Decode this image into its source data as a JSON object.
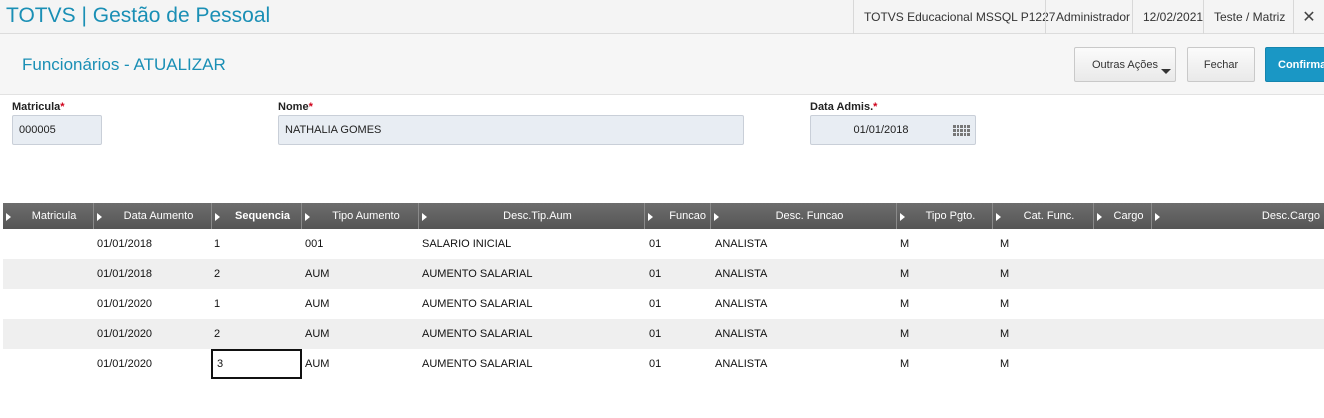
{
  "app": {
    "title": "TOTVS | Gestão de Pessoal"
  },
  "topbar": {
    "environment": "TOTVS Educacional MSSQL P1227",
    "user": "Administrador",
    "date": "12/02/2021",
    "branch": "Teste / Matriz",
    "close_icon": "✕"
  },
  "page": {
    "title": "Funcionários - ATUALIZAR",
    "buttons": {
      "more_actions": "Outras Ações",
      "close": "Fechar",
      "confirm": "Confirmar"
    }
  },
  "form": {
    "matricula": {
      "label": "Matricula",
      "required": "*",
      "value": "000005"
    },
    "nome": {
      "label": "Nome",
      "required": "*",
      "value": "NATHALIA GOMES"
    },
    "data_admis": {
      "label": "Data Admis.",
      "required": "*",
      "value": "01/01/2018"
    }
  },
  "grid": {
    "columns": [
      "Matricula",
      "Data Aumento",
      "Sequencia",
      "Tipo Aumento",
      "Desc.Tip.Aum",
      "Funcao",
      "Desc. Funcao",
      "Tipo Pgto.",
      "Cat. Func.",
      "Cargo",
      "Desc.Cargo"
    ],
    "rows": [
      [
        "",
        "01/01/2018",
        "1",
        "001",
        "SALARIO INICIAL",
        "01",
        "ANALISTA",
        "M",
        "M",
        "",
        ""
      ],
      [
        "",
        "01/01/2018",
        "2",
        "AUM",
        "AUMENTO SALARIAL",
        "01",
        "ANALISTA",
        "M",
        "M",
        "",
        ""
      ],
      [
        "",
        "01/01/2020",
        "1",
        "AUM",
        "AUMENTO SALARIAL",
        "01",
        "ANALISTA",
        "M",
        "M",
        "",
        ""
      ],
      [
        "",
        "01/01/2020",
        "2",
        "AUM",
        "AUMENTO SALARIAL",
        "01",
        "ANALISTA",
        "M",
        "M",
        "",
        ""
      ],
      [
        "",
        "01/01/2020",
        "3",
        "AUM",
        "AUMENTO SALARIAL",
        "01",
        "ANALISTA",
        "M",
        "M",
        "",
        ""
      ]
    ]
  },
  "colors": {
    "accent": "#1a8fb5",
    "confirm": "#1a97c5",
    "grid_header": "#5f5f5f",
    "required": "#d0021b"
  }
}
